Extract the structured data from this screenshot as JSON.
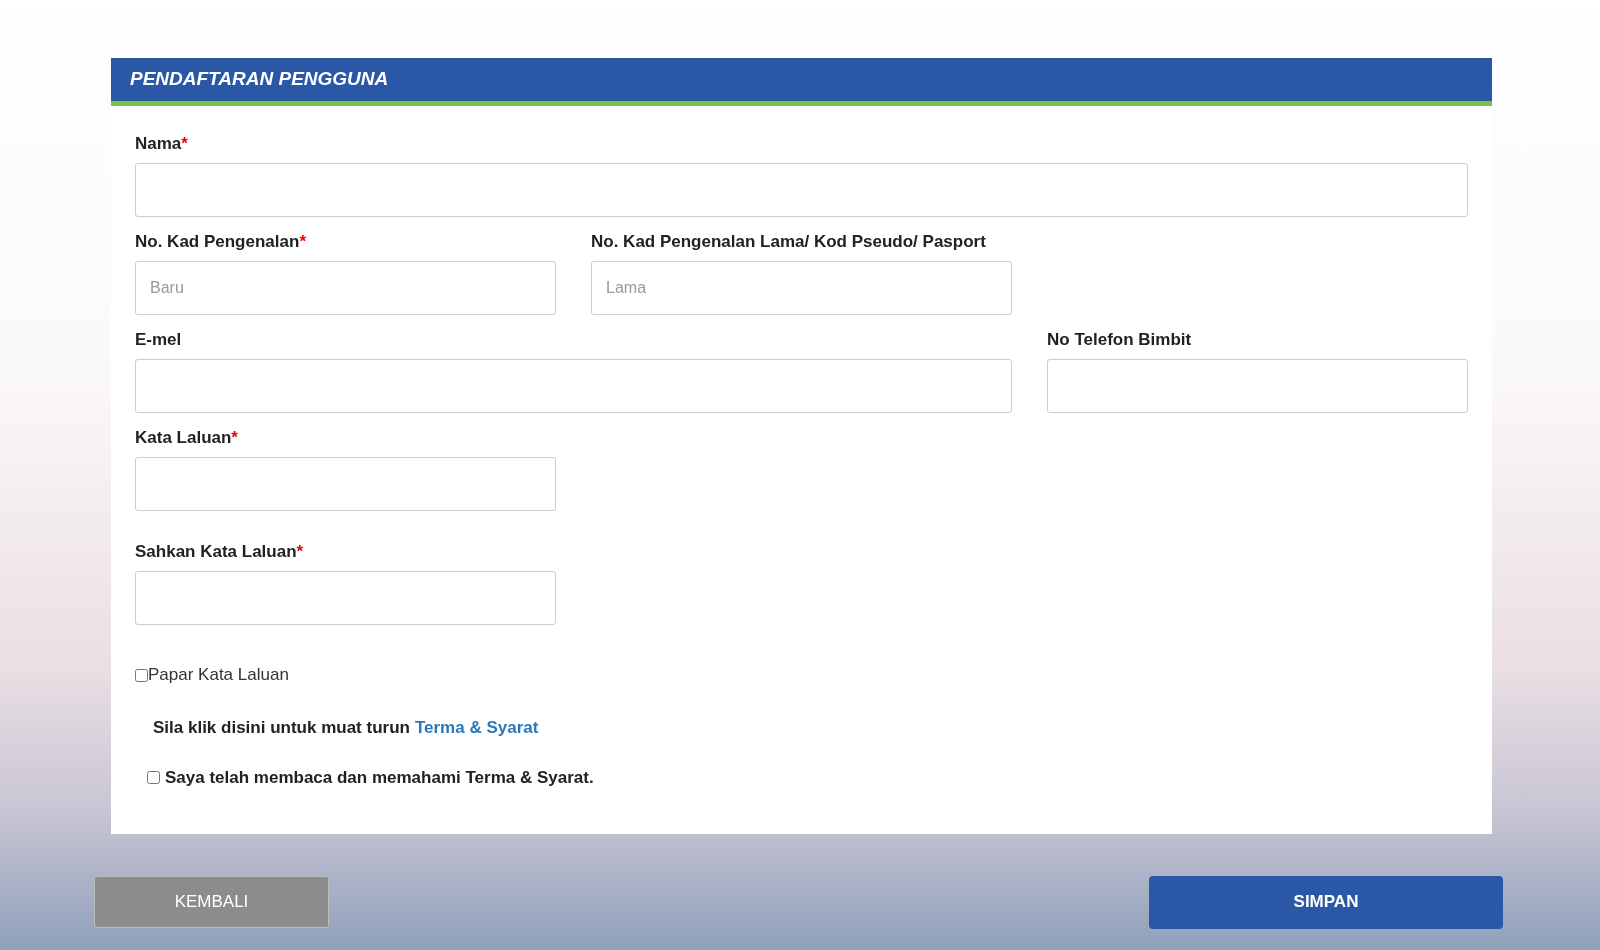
{
  "form": {
    "title": "PENDAFTARAN PENGGUNA",
    "rows": [
      [
        {
          "label": "Nama",
          "required_mark": "*"
        }
      ],
      [
        {
          "label": "No. Kad Pengenalan",
          "required_mark": "*",
          "placeholder": "Baru"
        },
        {
          "label": "No. Kad Pengenalan Lama/ Kod Pseudo/ Pasport",
          "placeholder": "Lama"
        }
      ],
      [
        {
          "label": "E-mel"
        },
        {
          "label": "No Telefon Bimbit"
        }
      ],
      [
        {
          "label": "Kata Laluan",
          "required_mark": "*"
        }
      ],
      [
        {
          "label": "Sahkan Kata Laluan",
          "required_mark": "*"
        }
      ]
    ],
    "show_password": {
      "label": "Papar Kata Laluan",
      "checked": false
    },
    "terms_note": {
      "text": "Sila klik disini untuk muat turun",
      "link": "Terma & Syarat"
    },
    "agreement": {
      "label": "Saya telah membaca dan memahami Terma & Syarat.",
      "checked": false
    }
  },
  "buttons": {
    "back": "KEMBALI",
    "save": "SIMPAN"
  }
}
